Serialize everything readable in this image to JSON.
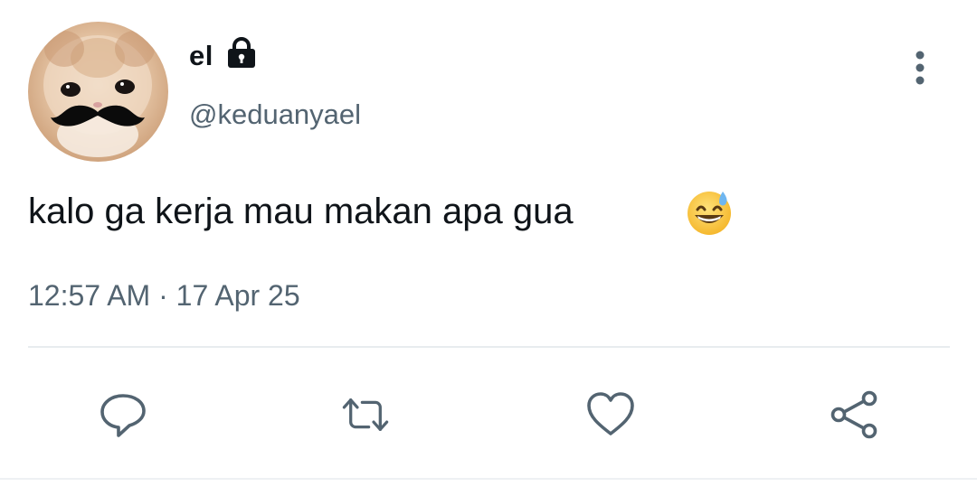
{
  "tweet": {
    "display_name": "el",
    "handle": "@keduanyael",
    "text": "kalo ga kerja mau makan apa gua",
    "emoji": "grinning-face-with-sweat",
    "timestamp": "12:57 AM · 17 Apr 25"
  },
  "icons": {
    "avatar": "cat-with-mustache-avatar",
    "lock": "lock-icon",
    "more": "more-vertical-icon",
    "reply": "reply-icon",
    "retweet": "retweet-icon",
    "like": "heart-icon",
    "share": "share-icon"
  },
  "colors": {
    "text": "#0f1419",
    "secondary": "#536471",
    "divider": "#e8ecef"
  }
}
